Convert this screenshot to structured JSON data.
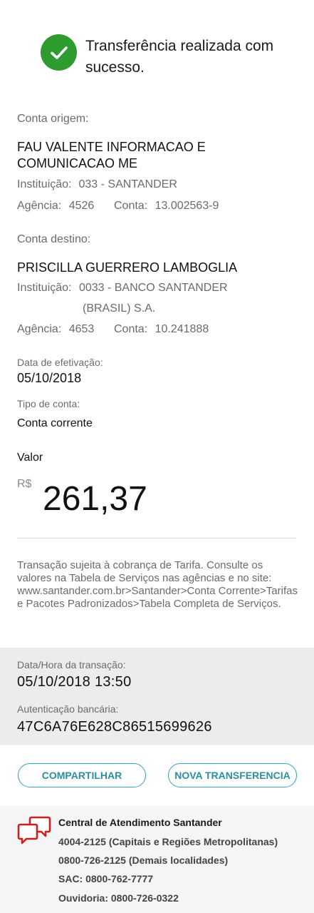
{
  "header": {
    "title": "Transferência realizada com sucesso.",
    "icon": "check-circle-icon",
    "icon_color": "#2e9b2e"
  },
  "origin": {
    "label": "Conta origem:",
    "name_line1": "FAU VALENTE INFORMACAO E",
    "name_line2": "COMUNICACAO ME",
    "institution_label": "Instituição:",
    "institution_value": "033 - SANTANDER",
    "agency_label": "Agência:",
    "agency_value": "4526",
    "account_label": "Conta:",
    "account_value": "13.002563-9"
  },
  "destination": {
    "label": "Conta destino:",
    "name": "PRISCILLA GUERRERO LAMBOGLIA",
    "institution_label": "Instituição:",
    "institution_value_line1": "0033 - BANCO SANTANDER",
    "institution_value_line2": "(BRASIL) S.A.",
    "agency_label": "Agência:",
    "agency_value": "4653",
    "account_label": "Conta:",
    "account_value": "10.241888"
  },
  "details": {
    "date_label": "Data de efetivação:",
    "date_value": "05/10/2018",
    "account_type_label": "Tipo de conta:",
    "account_type_value": "Conta corrente"
  },
  "amount": {
    "label": "Valor",
    "currency": "R$",
    "value": "261,37"
  },
  "notice": "Transação sujeita à cobrança de Tarifa. Consulte os valores na Tabela de Serviços nas agências e no site: www.santander.com.br>Santander>Conta Corrente>Tarifas e Pacotes Padronizados>Tabela Completa de Serviços.",
  "transaction": {
    "datetime_label": "Data/Hora da transação:",
    "datetime_value": "05/10/2018 13:50",
    "auth_label": "Autenticação bancária:",
    "auth_value": "47C6A76E628C86515699626"
  },
  "actions": {
    "share_label": "COMPARTILHAR",
    "new_transfer_label": "NOVA TRANSFERENCIA",
    "accent_color": "#33a4b3"
  },
  "support": {
    "icon": "chat-bubbles-icon",
    "icon_color": "#cc1f1f",
    "title": "Central de Atendimento Santander",
    "line1": "4004-2125 (Capitais e Regiões Metropolitanas)",
    "line2": "0800-726-2125 (Demais localidades)",
    "line3": "SAC: 0800-762-7777",
    "line4": "Ouvidoria: 0800-726-0322"
  }
}
